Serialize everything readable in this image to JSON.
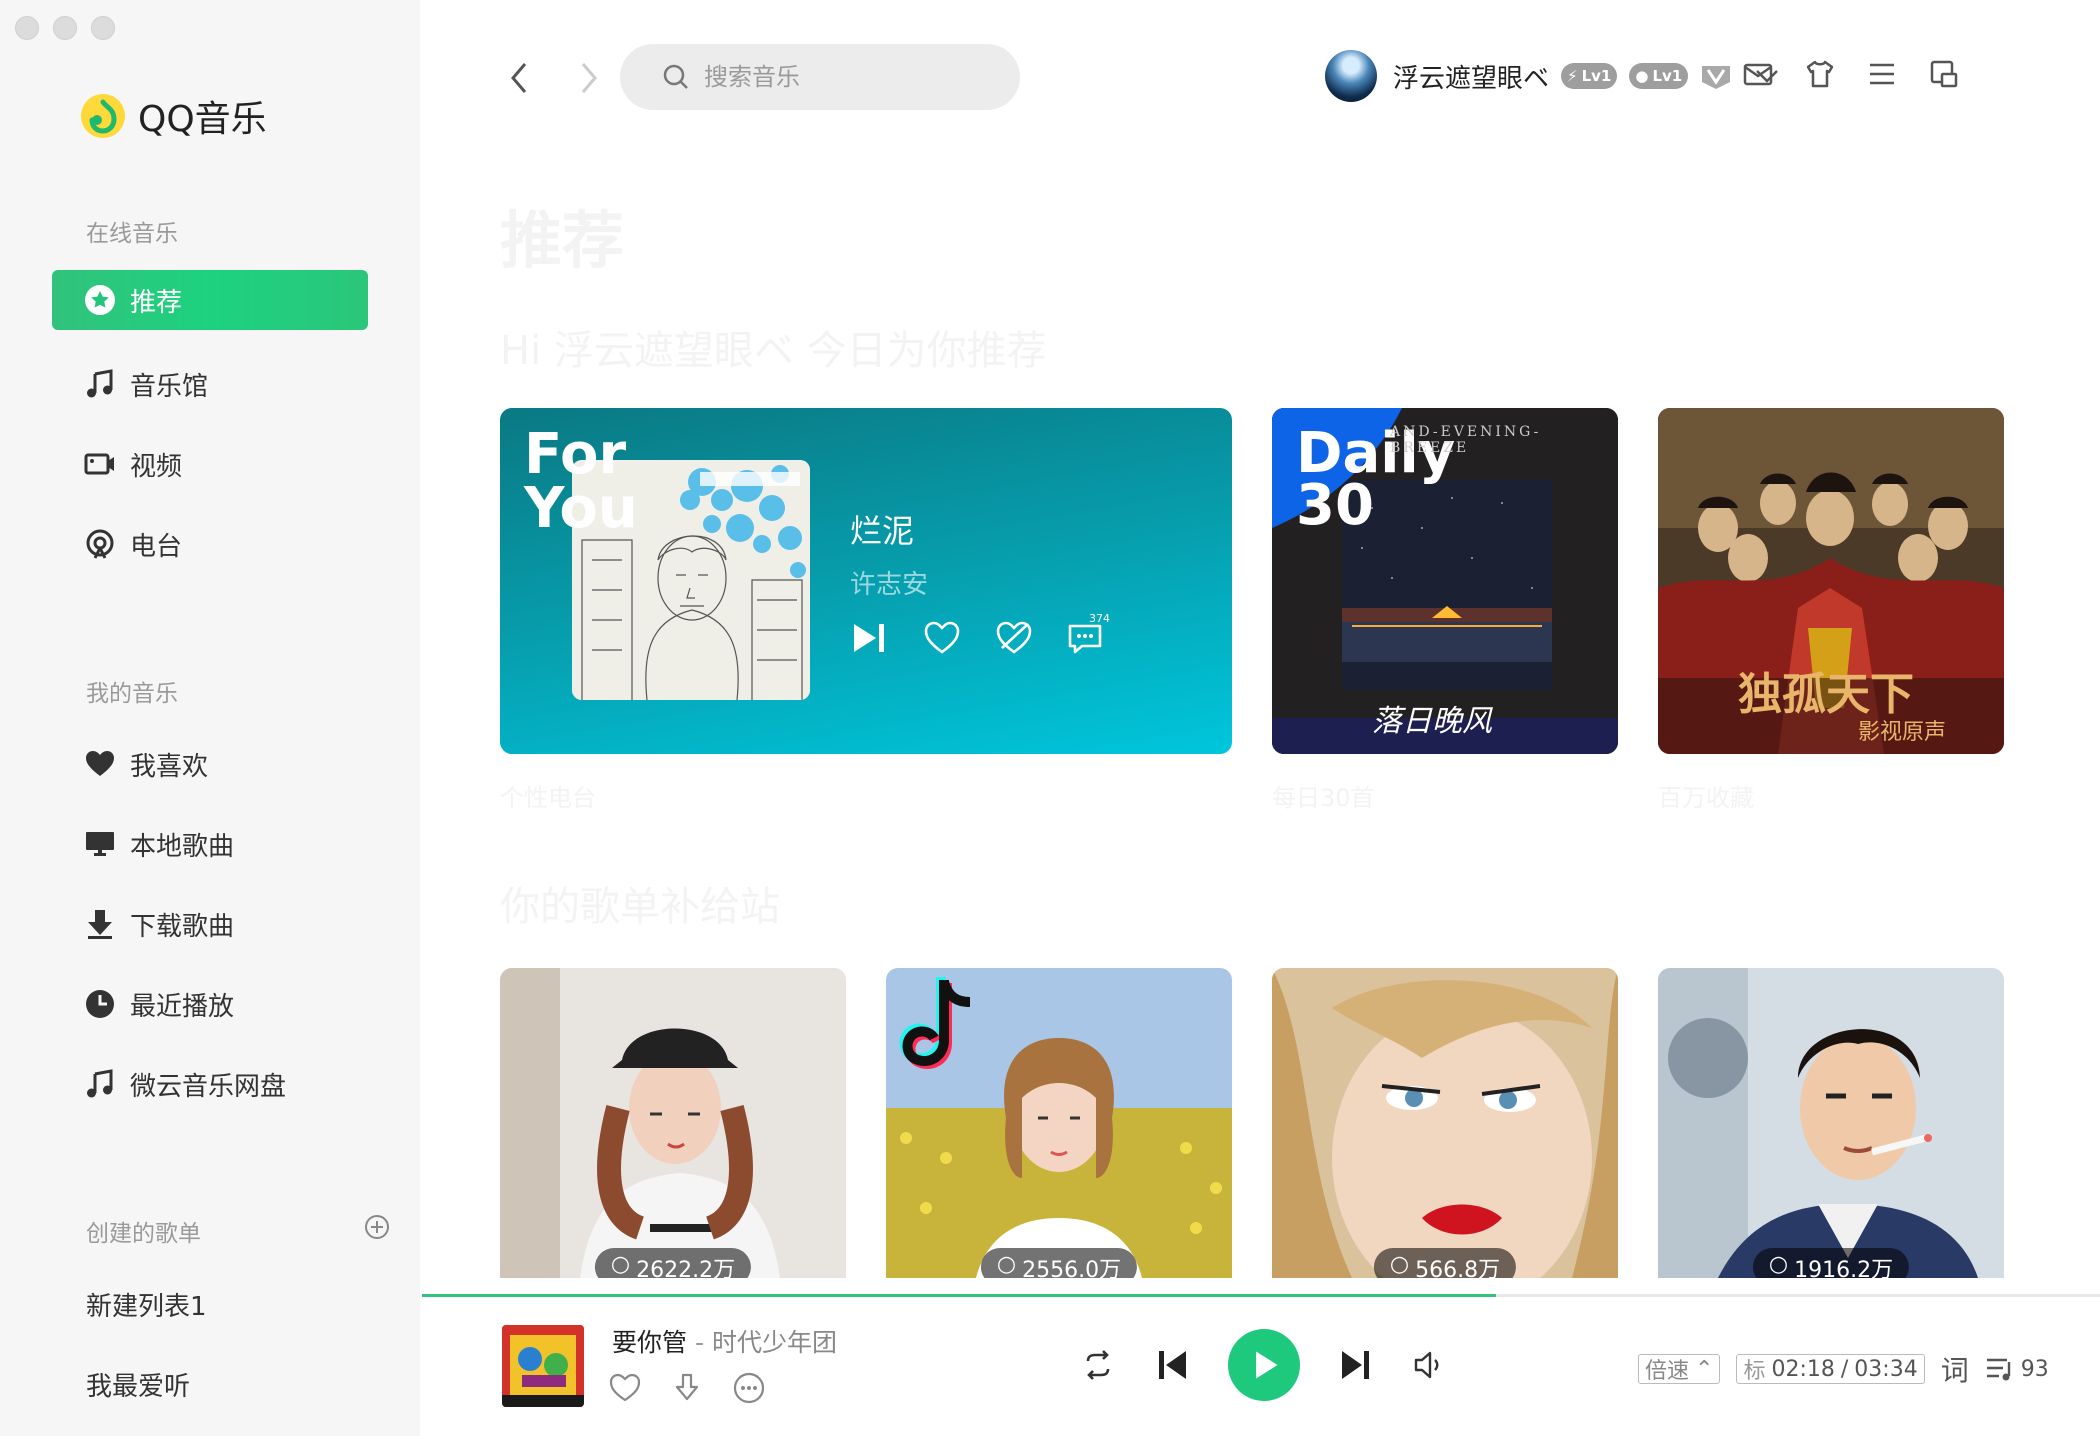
{
  "app": {
    "name": "QQ音乐"
  },
  "sidebar": {
    "online_title": "在线音乐",
    "online_items": [
      {
        "label": "推荐",
        "icon": "star-icon",
        "active": true
      },
      {
        "label": "音乐馆",
        "icon": "music-note-icon"
      },
      {
        "label": "视频",
        "icon": "video-icon"
      },
      {
        "label": "电台",
        "icon": "radio-icon"
      }
    ],
    "my_title": "我的音乐",
    "my_items": [
      {
        "label": "我喜欢",
        "icon": "heart-icon"
      },
      {
        "label": "本地歌曲",
        "icon": "monitor-icon"
      },
      {
        "label": "下载歌曲",
        "icon": "download-icon"
      },
      {
        "label": "最近播放",
        "icon": "clock-icon"
      },
      {
        "label": "微云音乐网盘",
        "icon": "music-note-icon"
      }
    ],
    "created_title": "创建的歌单",
    "playlists": [
      "新建列表1",
      "我最爱听"
    ]
  },
  "header": {
    "search_placeholder": "搜索音乐",
    "username": "浮云遮望眼ベ",
    "badge1": "Lv1",
    "badge2": "Lv1"
  },
  "main": {
    "title": "推荐",
    "greeting": "Hi 浮云遮望眼ベ 今日为你推荐",
    "for_you": {
      "brand_line1": "For",
      "brand_line2": "You",
      "song": "烂泥",
      "artist": "许志安",
      "comment_count": "374",
      "label": "个性电台"
    },
    "daily": {
      "brand_line1": "Daily",
      "brand_line2": "30",
      "cover_text": "AND-EVENING-BREEZE",
      "cover_script": "落日晚风",
      "label": "每日30首"
    },
    "drama": {
      "cover_text": "独孤天下",
      "cover_sub": "影视原声",
      "label": "百万收藏"
    },
    "section_title": "你的歌单补给站",
    "playlists": [
      {
        "plays": "2622.2万"
      },
      {
        "plays": "2556.0万"
      },
      {
        "plays": "566.8万"
      },
      {
        "plays": "1916.2万"
      }
    ]
  },
  "player": {
    "title": "要你管",
    "separator": "-",
    "artist": "时代少年团",
    "speed": "倍速",
    "quality": "标",
    "current_time": "02:18",
    "divider": "/",
    "duration": "03:34",
    "lyric": "词",
    "queue_count": "93",
    "progress": 0.64
  },
  "colors": {
    "accent": "#31c27c",
    "for_you_gradient_end": "#00c6dc"
  }
}
